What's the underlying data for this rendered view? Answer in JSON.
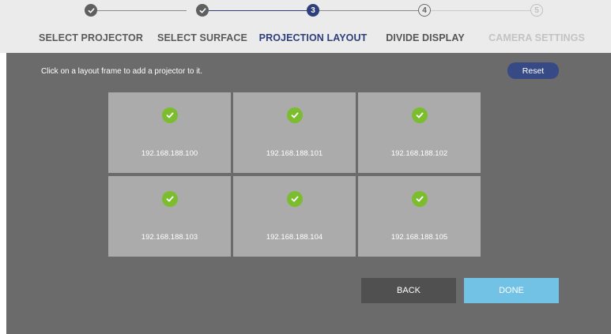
{
  "steps": [
    {
      "label": "SELECT PROJECTOR",
      "number": "",
      "state": "done"
    },
    {
      "label": "SELECT SURFACE",
      "number": "",
      "state": "done"
    },
    {
      "label": "PROJECTION LAYOUT",
      "number": "3",
      "state": "current"
    },
    {
      "label": "DIVIDE DISPLAY",
      "number": "4",
      "state": "next"
    },
    {
      "label": "CAMERA SETTINGS",
      "number": "5",
      "state": "future"
    }
  ],
  "instruction": "Click on a layout frame to add a projector to it.",
  "reset_label": "Reset",
  "frames": [
    {
      "ip": "192.168.188.100",
      "checked": true
    },
    {
      "ip": "192.168.188.101",
      "checked": true
    },
    {
      "ip": "192.168.188.102",
      "checked": true
    },
    {
      "ip": "192.168.188.103",
      "checked": true
    },
    {
      "ip": "192.168.188.104",
      "checked": true
    },
    {
      "ip": "192.168.188.105",
      "checked": true
    }
  ],
  "back_label": "BACK",
  "done_label": "DONE",
  "colors": {
    "accent": "#2e3f7c",
    "check": "#7bbd2f",
    "done_button": "#72c2e6",
    "panel": "#6b6b6b",
    "frame": "#ababab"
  },
  "icons": {
    "completed_step": "checkmark-icon",
    "assigned_frame": "checkmark-circle-icon"
  }
}
